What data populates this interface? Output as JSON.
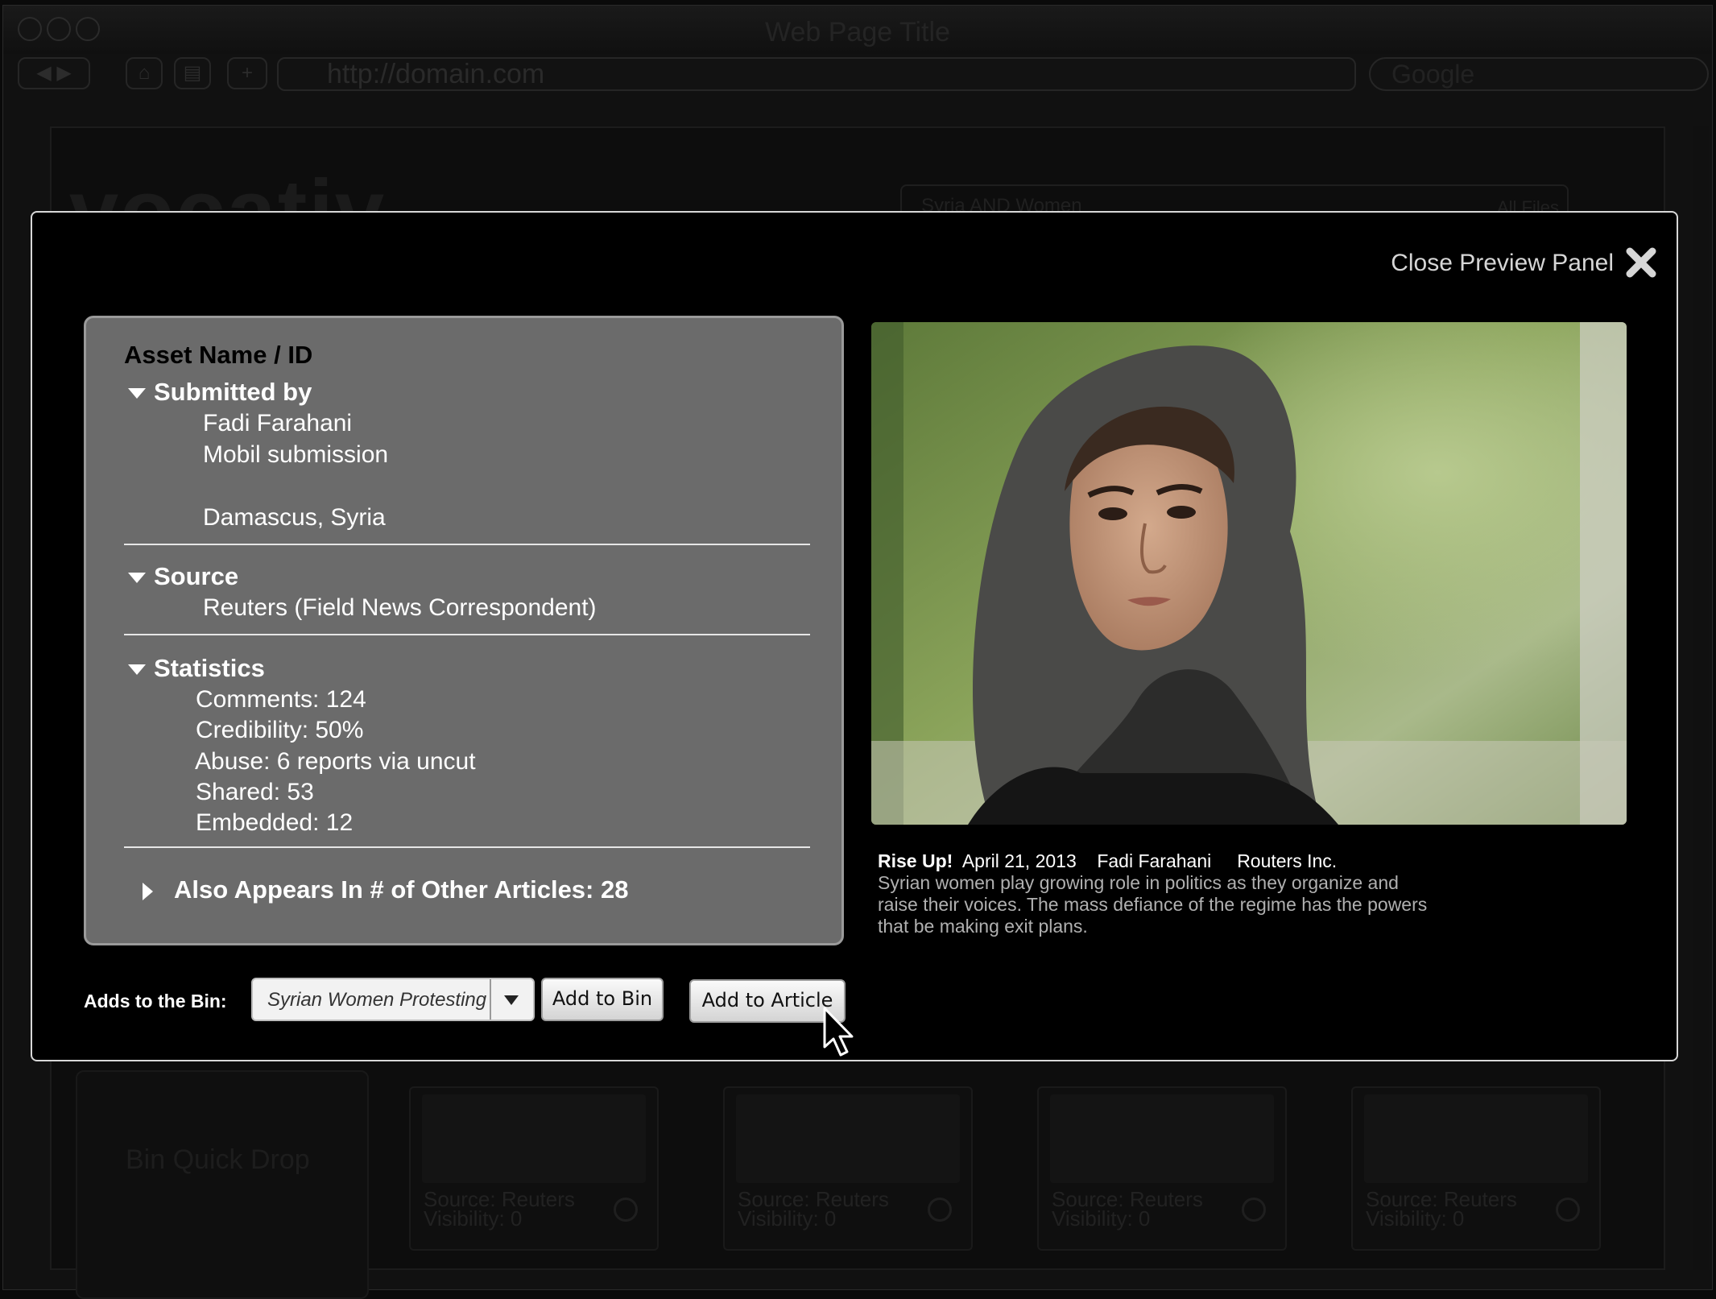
{
  "browser": {
    "window_title": "Web Page Title",
    "url": "http://domain.com",
    "search_placeholder": "Google"
  },
  "background_page": {
    "logo": "vocativ",
    "search_value": "Syria AND Women",
    "filter_label": "All Files",
    "bin_quick_drop": "Bin Quick Drop",
    "thumbnails": [
      {
        "source": "Source: Reuters",
        "visibility": "Visibility: 0"
      },
      {
        "source": "Source: Reuters",
        "visibility": "Visibility: 0"
      },
      {
        "source": "Source: Reuters",
        "visibility": "Visibility: 0"
      },
      {
        "source": "Source: Reuters",
        "visibility": "Visibility: 0"
      }
    ]
  },
  "modal": {
    "close_label": "Close Preview Panel",
    "asset_name": "Asset Name / ID",
    "submitted_by": {
      "heading": "Submitted by",
      "name": "Fadi Farahani",
      "method": "Mobil submission",
      "location": "Damascus, Syria"
    },
    "source": {
      "heading": "Source",
      "value": "Reuters (Field News Correspondent)"
    },
    "statistics": {
      "heading": "Statistics",
      "comments": "Comments: 124",
      "credibility": "Credibility: 50%",
      "abuse": "Abuse: 6 reports via uncut",
      "shared": "Shared: 53",
      "embedded": "Embedded: 12"
    },
    "also_appears": "Also Appears In # of Other Articles: 28",
    "caption": {
      "title": "Rise Up!",
      "date": "April 21, 2013",
      "author": "Fadi Farahani",
      "agency": "Routers Inc.",
      "description": "Syrian women play growing role in politics as they organize and raise their voices. The mass defiance of the regime has the powers that be making exit plans."
    },
    "bin_label": "Adds to  the Bin:",
    "bin_selected": "Syrian Women Protesting",
    "add_to_bin": "Add to Bin",
    "add_to_article": "Add to Article"
  },
  "colors": {
    "modal_bg": "#000000",
    "panel_bg": "#6b6b6b",
    "modal_border": "#d8d8d8"
  },
  "icons": [
    "close-x-icon",
    "dropdown-arrow-icon",
    "disclosure-triangle-icon",
    "mouse-pointer-icon",
    "magnifier-icon"
  ]
}
